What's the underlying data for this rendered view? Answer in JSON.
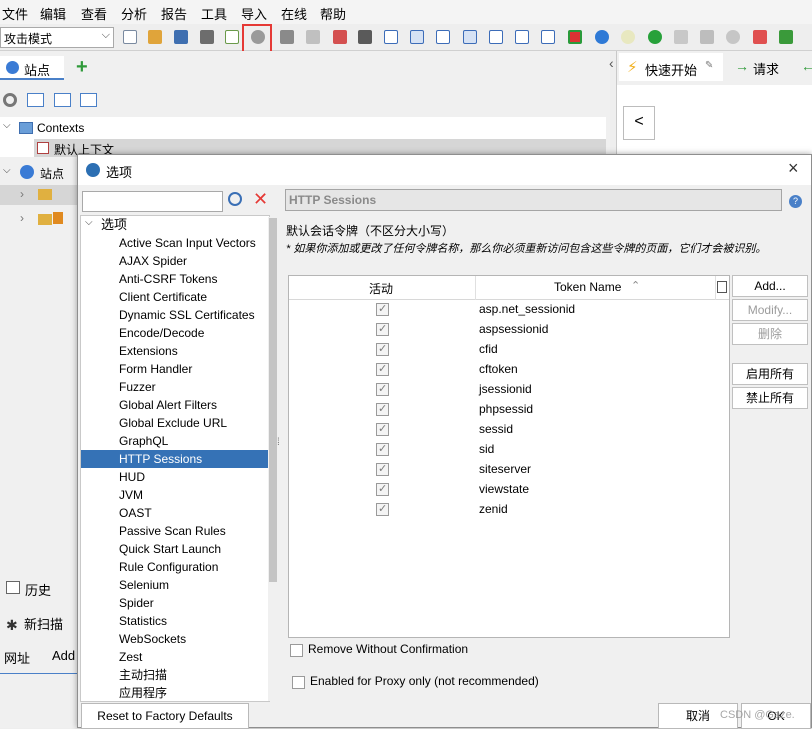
{
  "menu": [
    "文件",
    "编辑",
    "查看",
    "分析",
    "报告",
    "工具",
    "导入",
    "在线",
    "帮助"
  ],
  "toolbar": {
    "mode": "攻击模式"
  },
  "left": {
    "tab_sites": "站点",
    "contexts": "Contexts",
    "default_context": "默认上下文",
    "sites_root": "站点",
    "tab_history": "历史",
    "tab_new_scan": "新扫描",
    "col_url": "网址",
    "col_add": "Add"
  },
  "right": {
    "tab_quick_start": "快速开始",
    "tab_request": "请求",
    "back_button": "<"
  },
  "dialog": {
    "title": "选项",
    "tree_root": "选项",
    "tree_items": [
      "Active Scan Input Vectors",
      "AJAX Spider",
      "Anti-CSRF Tokens",
      "Client Certificate",
      "Dynamic SSL Certificates",
      "Encode/Decode",
      "Extensions",
      "Form Handler",
      "Fuzzer",
      "Global Alert Filters",
      "Global Exclude URL",
      "GraphQL",
      "HTTP Sessions",
      "HUD",
      "JVM",
      "OAST",
      "Passive Scan Rules",
      "Quick Start Launch",
      "Rule Configuration",
      "Selenium",
      "Spider",
      "Statistics",
      "WebSockets",
      "Zest",
      "主动扫描",
      "应用程序"
    ],
    "panel_title": "HTTP Sessions",
    "section_label": "默认会话令牌（不区分大小写）",
    "note": "* 如果你添加或更改了任何令牌名称，那么你必须重新访问包含这些令牌的页面，它们才会被识别。",
    "col_active": "活动",
    "col_token": "Token Name",
    "tokens": [
      "asp.net_sessionid",
      "aspsessionid",
      "cfid",
      "cftoken",
      "jsessionid",
      "phpsessid",
      "sessid",
      "sid",
      "siteserver",
      "viewstate",
      "zenid"
    ],
    "btn_add": "Add...",
    "btn_modify": "Modify...",
    "btn_delete": "删除",
    "btn_enable_all": "启用所有",
    "btn_disable_all": "禁止所有",
    "opt_remove": "Remove Without Confirmation",
    "opt_proxy": "Enabled for Proxy only (not recommended)",
    "btn_reset": "Reset to Factory Defaults",
    "btn_cancel": "取消",
    "btn_ok": "OK",
    "watermark": "CSDN @Gaze."
  }
}
